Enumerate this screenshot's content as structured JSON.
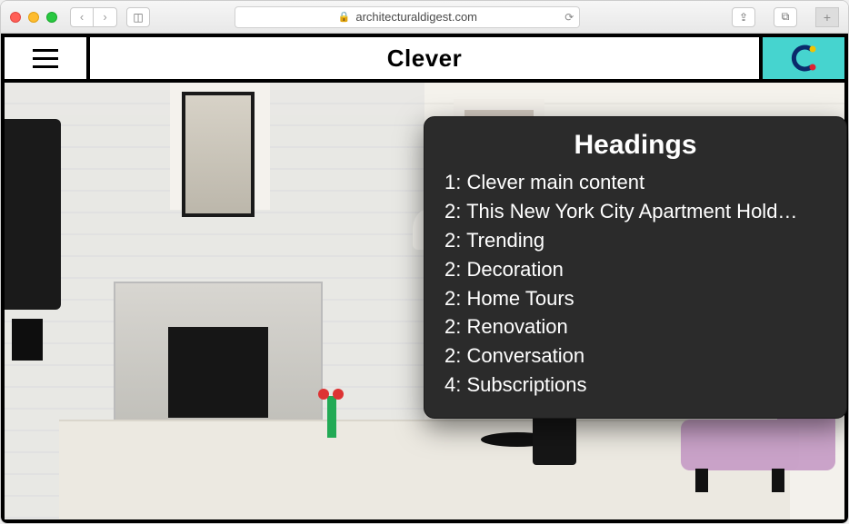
{
  "browser": {
    "url_display": "architecturaldigest.com"
  },
  "site": {
    "brand": "Clever"
  },
  "rotor": {
    "title": "Headings",
    "items": [
      {
        "level": "1",
        "text": "Clever main content"
      },
      {
        "level": "2",
        "text": "This New York City Apartment Hold…"
      },
      {
        "level": "2",
        "text": "Trending"
      },
      {
        "level": "2",
        "text": "Decoration"
      },
      {
        "level": "2",
        "text": "Home Tours"
      },
      {
        "level": "2",
        "text": "Renovation"
      },
      {
        "level": "2",
        "text": "Conversation"
      },
      {
        "level": "4",
        "text": "Subscriptions"
      }
    ]
  }
}
